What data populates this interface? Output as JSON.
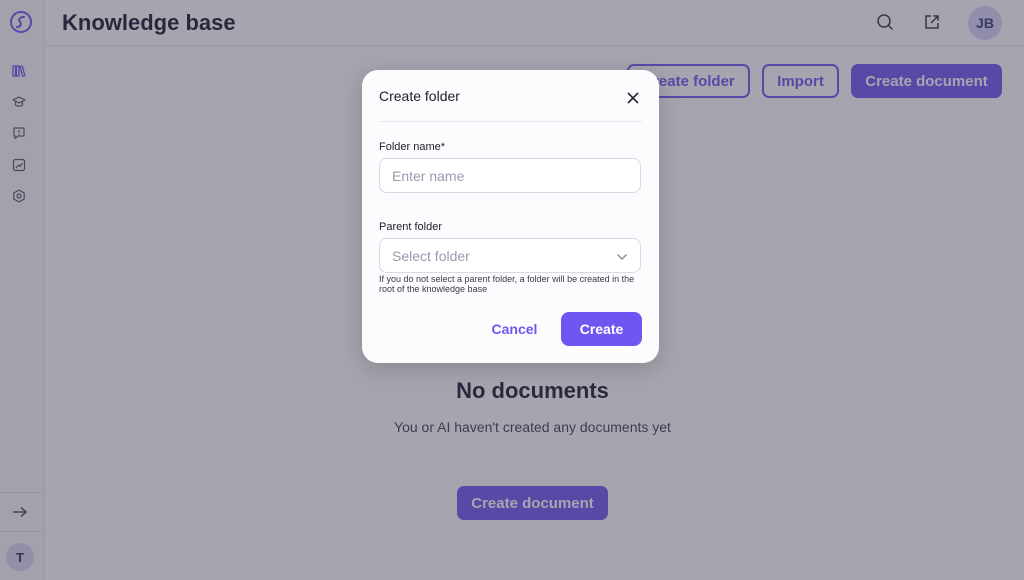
{
  "header": {
    "title": "Knowledge base",
    "user_initials": "JB",
    "icons": [
      "search-icon",
      "external-link-icon"
    ]
  },
  "sidebar": {
    "items": [
      {
        "icon": "books-icon"
      },
      {
        "icon": "graduation-cap-icon"
      },
      {
        "icon": "chat-alert-icon"
      },
      {
        "icon": "chart-icon"
      },
      {
        "icon": "settings-hexagon-icon"
      }
    ],
    "expand_icon": "arrow-right-icon",
    "workspace_initial": "T"
  },
  "toolbar": {
    "create_folder_label": "Create folder",
    "import_label": "Import",
    "create_document_label": "Create document"
  },
  "empty_state": {
    "title": "No documents",
    "text": "You or AI haven't created any documents yet",
    "button_label": "Create document"
  },
  "modal": {
    "title": "Create folder",
    "folder_name_label": "Folder name*",
    "folder_name_placeholder": "Enter name",
    "folder_name_value": "",
    "parent_folder_label": "Parent folder",
    "parent_folder_placeholder": "Select folder",
    "hint": "If you do not select a parent folder, a folder will be created in the root of the knowledge base",
    "cancel_label": "Cancel",
    "create_label": "Create"
  },
  "colors": {
    "accent": "#6f56f0",
    "overlay": "rgba(60,58,80,0.46)"
  }
}
